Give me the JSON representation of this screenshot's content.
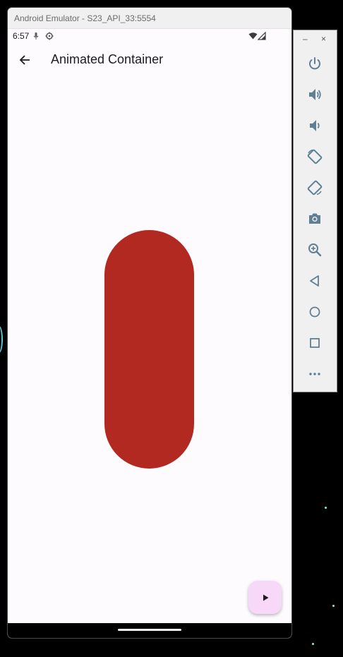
{
  "window": {
    "title": "Android Emulator - S23_API_33:5554"
  },
  "status_bar": {
    "time": "6:57"
  },
  "app_bar": {
    "title": "Animated Container"
  },
  "animated_container": {
    "color": "#b22922"
  },
  "toolbar": {
    "minimize": "–",
    "close": "×",
    "buttons": [
      "power-icon",
      "volume-up-icon",
      "volume-down-icon",
      "rotate-left-icon",
      "rotate-right-icon",
      "camera-icon",
      "zoom-icon",
      "back-icon",
      "home-icon",
      "overview-icon",
      "more-icon"
    ]
  },
  "colors": {
    "accent_icon": "#5f7f94",
    "fab_background": "#f8d8f9",
    "screen_background": "#fefbfe"
  }
}
